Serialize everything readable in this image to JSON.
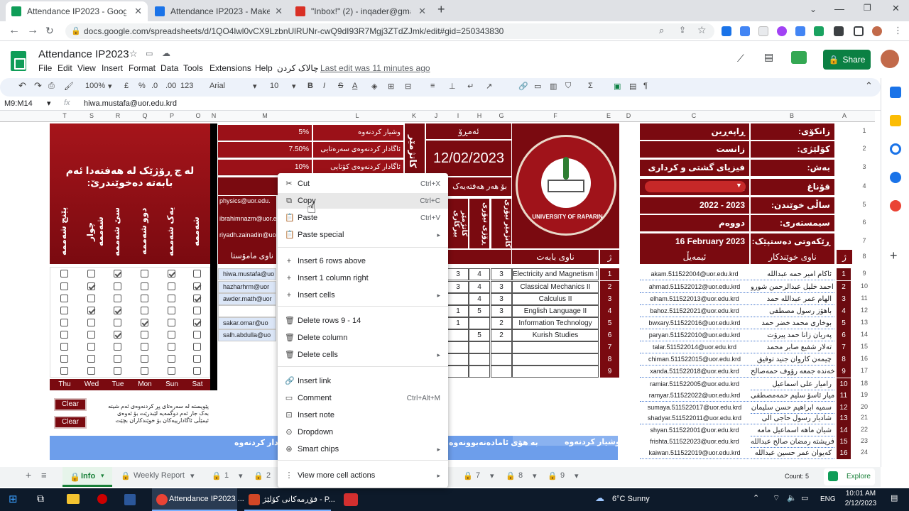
{
  "browser": {
    "tabs": [
      {
        "title": "Attendance IP2023 - Google She",
        "color": "#0f9d58"
      },
      {
        "title": "Attendance IP2023 - Make a cop",
        "color": "#1a73e8"
      },
      {
        "title": "\"Inbox!\" (2) - inqader@gmail.con",
        "color": "#d93025"
      }
    ],
    "new_tab": "+",
    "url": "docs.google.com/spreadsheets/d/1QO4lwl0vCX9LzbnUlRUNr-cwQ9dI93R7Mgj3ZTdZJmk/edit#gid=250343830"
  },
  "app": {
    "title": "Attendance IP2023",
    "menus": [
      "File",
      "Edit",
      "View",
      "Insert",
      "Format",
      "Data",
      "Tools",
      "Extensions",
      "Help",
      "چالاک کردن"
    ],
    "last_edit": "Last edit was 11 minutes ago",
    "share": "Share"
  },
  "toolbar": {
    "zoom": "100%",
    "currency": "£",
    "percent": "%",
    "dec_less": ".0",
    "dec_more": ".00",
    "format": "123",
    "font": "Arial",
    "size": "10",
    "bold": "B",
    "italic": "I",
    "strike": "S",
    "textcolor": "A"
  },
  "formula_bar": {
    "name_box": "M9:M14",
    "fx": "fx",
    "value": "hiwa.mustafa@uor.edu.krd"
  },
  "columns": [
    "T",
    "S",
    "R",
    "Q",
    "P",
    "O",
    "N",
    "M",
    "L",
    "K",
    "J",
    "I",
    "H",
    "G",
    "F",
    "E",
    "D",
    "C",
    "B",
    "A"
  ],
  "rows": [
    "1",
    "2",
    "3",
    "4",
    "5",
    "6",
    "7",
    "8",
    "9",
    "10",
    "11",
    "12",
    "13",
    "14",
    "15",
    "16",
    "17",
    "18",
    "19",
    "20",
    "21",
    "22",
    "23",
    "24"
  ],
  "sheet": {
    "heading": "لە چ ڕۆژێک لە هەفتەدا ئەم بابەتە دەخوێندرێ:",
    "days_vertical": [
      "شەممە",
      "یەک شەممە",
      "دوو شەممە",
      "سێ شەممە",
      "چوار شەممە",
      "پێنج شەممە"
    ],
    "days_en": [
      "Thu",
      "Wed",
      "Tue",
      "Mon",
      "Sun",
      "Sat"
    ],
    "percent_rows": [
      {
        "label": "وشیار کردنەوە",
        "value": "5%"
      },
      {
        "label": "ئاگادار کردنەوەی سەرەتایی",
        "value": "7.50%"
      },
      {
        "label": "ئاگادار کردنەوەی کۆتایی",
        "value": "10%"
      }
    ],
    "teacher_emails_top": [
      "physics@uor.edu.",
      "ibrahimnazm@uor.edu.",
      "riyadh.zainadin@uor."
    ],
    "teacher_header": "ناوی مامۆستا",
    "teacher_emails": [
      "hiwa.mustafa@uo",
      "hazharhrm@uor",
      "awder.math@uor",
      "",
      "sakar.omar@uo",
      "salh.abdulla@uo"
    ],
    "date_label": "ئەمڕۆ",
    "date_value": "12/02/2023",
    "week_label": "بۆ هەر هەفتەیەک",
    "side_label": "کاتژمێر",
    "hours_headers": [
      "کاتژمێر بیرکاری",
      "ڕۆژی تیۆری",
      "کاتژمێر تیۆری"
    ],
    "hours": [
      [
        "3",
        "4",
        "3"
      ],
      [
        "3",
        "4",
        "3"
      ],
      [
        "",
        "4",
        "3"
      ],
      [
        "1",
        "5",
        "3"
      ],
      [
        "1",
        "",
        "2"
      ],
      [
        "",
        "5",
        "2"
      ]
    ],
    "subject_header": "ناوی بابەت",
    "subjects": [
      "Electricity and Magnetism II",
      "Classical Mechanics II",
      "Calculus II",
      "English Language II",
      "Information Technology",
      "Kurish Studies",
      "",
      "",
      ""
    ],
    "subject_nums": [
      "1",
      "2",
      "3",
      "4",
      "5",
      "6",
      "7",
      "8",
      "9"
    ],
    "num_header": "ژ",
    "logo_text": "UNIVERSITY OF RAPARIN",
    "info_rows": [
      {
        "label": "زانکۆی:",
        "value": "ڕاپەڕین"
      },
      {
        "label": "کۆلێژی:",
        "value": "زانست"
      },
      {
        "label": "بەش:",
        "value": "فیزیای گشتی و کرداری"
      },
      {
        "label": "قۆناغ",
        "value": "یەکەم"
      },
      {
        "label": "ساڵی خوێندن:",
        "value": "2022 - 2023"
      },
      {
        "label": "سیمستەری:",
        "value": "دووەم"
      },
      {
        "label": "ڕێکەوتی دەستپێک:",
        "value": "16 February 2023"
      }
    ],
    "student_email_header": "ئیمەیڵ",
    "student_name_header": "ناوی خوێندکار",
    "students": [
      {
        "num": "1",
        "email": "akam.511522004@uor.edu.krd",
        "name": "ئاکام امیر حمە عبداللە"
      },
      {
        "num": "2",
        "email": "ahmad.511522012@uor.edu.krd",
        "name": "احمد خليل عبدالرحمن شورو"
      },
      {
        "num": "3",
        "email": "elham.511522013@uor.edu.krd",
        "name": "الهام عمر عبداللە حمد"
      },
      {
        "num": "4",
        "email": "bahoz.511522021@uor.edu.krd",
        "name": "باهۆز رسول مصطفى"
      },
      {
        "num": "5",
        "email": "bwxary.511522016@uor.edu.krd",
        "name": "بوخاری محمد خضر حمد"
      },
      {
        "num": "6",
        "email": "paryan.511522010@uor.edu.krd",
        "name": "پەریان  زانا  حمد پیرۆت"
      },
      {
        "num": "7",
        "email": "talar.511522014@uor.edu.krd",
        "name": "تەلار شفیع صابر محمد"
      },
      {
        "num": "8",
        "email": "chiman.511522015@uor.edu.krd",
        "name": "چیمەن کاروان جنید توفیق"
      },
      {
        "num": "9",
        "email": "xanda.511522018@uor.edu.krd",
        "name": "خەندە جمعە رؤوف حمەصالح"
      },
      {
        "num": "10",
        "email": "ramiar.511522005@uor.edu.krd",
        "name": "رامیار علی اسماعیل"
      },
      {
        "num": "11",
        "email": "ramyar.511522022@uor.edu.krd",
        "name": "رامیار ئاسۆ سلیم حمەمصطفى"
      },
      {
        "num": "12",
        "email": "sumaya.511522017@uor.edu.krd",
        "name": "سمیە ابراهیم حسن سلیمان"
      },
      {
        "num": "13",
        "email": "shadyar.511522011@uor.edu.krd",
        "name": "شادیار رسول حاجی الی"
      },
      {
        "num": "14",
        "email": "shyan.511522001@uor.edu.krd",
        "name": "شیان ماهە اسماعیل مامە"
      },
      {
        "num": "15",
        "email": "frishta.511522023@uor.edu.krd",
        "name": "فریشتە رمضان صالح عبداللە"
      },
      {
        "num": "16",
        "email": "kaiwan.511522019@uor.edu.krd",
        "name": "کەیوان عمر حسین عبداللە"
      }
    ],
    "checks": [
      [
        false,
        false,
        true,
        false,
        true,
        false
      ],
      [
        false,
        true,
        false,
        false,
        false,
        true
      ],
      [
        false,
        false,
        false,
        false,
        false,
        true
      ],
      [
        false,
        true,
        true,
        false,
        false,
        false
      ],
      [
        false,
        false,
        false,
        true,
        false,
        true
      ],
      [
        false,
        false,
        true,
        false,
        false,
        false
      ],
      [
        false,
        false,
        false,
        false,
        false,
        false
      ],
      [
        false,
        false,
        false,
        false,
        false,
        false
      ],
      [
        false,
        false,
        false,
        false,
        false,
        false
      ]
    ],
    "clear_buttons": [
      "Clear",
      "Clear"
    ],
    "note": "پێویستە لە سەرەتای پڕ کردنەوەی ئەم شیتە بەک جار ئەم دوگمەیە لێبدرێت بۆ ئەوەی ئیمێڵی ئاگادارییەکان بۆ خوێندکاران بچێت",
    "bottom_labels": [
      "ئاگادار کردنەوە",
      "بە هۆی ئامادەنەبوونەوە",
      "وشیار کردنەوە"
    ]
  },
  "context_menu": {
    "items": [
      {
        "label": "Cut",
        "shortcut": "Ctrl+X",
        "icon": "scissors-icon"
      },
      {
        "label": "Copy",
        "shortcut": "Ctrl+C",
        "icon": "copy-icon"
      },
      {
        "label": "Paste",
        "shortcut": "Ctrl+V",
        "icon": "paste-icon"
      },
      {
        "label": "Paste special",
        "shortcut": "",
        "icon": "paste-icon"
      },
      {
        "label": "Insert 6 rows above",
        "shortcut": "",
        "icon": "plus-icon"
      },
      {
        "label": "Insert 1 column right",
        "shortcut": "",
        "icon": "plus-icon"
      },
      {
        "label": "Insert cells",
        "shortcut": "",
        "icon": "plus-icon"
      },
      {
        "label": "Delete rows 9 - 14",
        "shortcut": "",
        "icon": "trash-icon"
      },
      {
        "label": "Delete column",
        "shortcut": "",
        "icon": "trash-icon"
      },
      {
        "label": "Delete cells",
        "shortcut": "",
        "icon": "trash-icon"
      },
      {
        "label": "Insert link",
        "shortcut": "",
        "icon": "link-icon"
      },
      {
        "label": "Comment",
        "shortcut": "Ctrl+Alt+M",
        "icon": "comment-icon"
      },
      {
        "label": "Insert note",
        "shortcut": "",
        "icon": "note-icon"
      },
      {
        "label": "Dropdown",
        "shortcut": "",
        "icon": "dropdown-icon"
      },
      {
        "label": "Smart chips",
        "shortcut": "",
        "icon": "chip-icon"
      },
      {
        "label": "View more cell actions",
        "shortcut": "",
        "icon": "more-icon"
      }
    ]
  },
  "sheet_tabs": [
    "Info",
    "Weekly Report",
    "1",
    "2",
    "7",
    "8",
    "9"
  ],
  "status": {
    "count": "Count: 5",
    "explore": "Explore"
  },
  "taskbar": {
    "items": [
      "Attendance IP2023 ...",
      "فۆڕمەکانی کۆلێژ - P..."
    ],
    "weather": "6°C  Sunny",
    "lang": "ENG",
    "time": "10:01 AM",
    "date": "2/12/2023"
  }
}
